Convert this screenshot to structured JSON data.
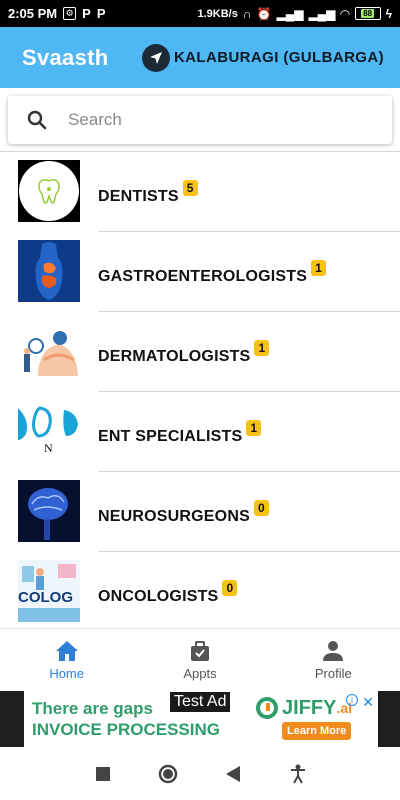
{
  "status_bar": {
    "time": "2:05 PM",
    "left_icons": [
      "settings-icon",
      "p-icon",
      "p-icon"
    ],
    "p_glyph": "P",
    "speed": "1.9KB/s",
    "battery": "88"
  },
  "app_bar": {
    "title": "Svaasth",
    "location": "KALABURAGI (GULBARGA)",
    "color": "#4fb7f3"
  },
  "search": {
    "placeholder": "Search"
  },
  "specialties": [
    {
      "label": "DENTISTS",
      "count": "5",
      "icon": "tooth-icon"
    },
    {
      "label": "GASTROENTEROLOGISTS",
      "count": "1",
      "icon": "digestive-system-icon"
    },
    {
      "label": "DERMATOLOGISTS",
      "count": "1",
      "icon": "skin-exam-icon"
    },
    {
      "label": "ENT SPECIALISTS",
      "count": "1",
      "icon": "ear-nose-icon"
    },
    {
      "label": "NEUROSURGEONS",
      "count": "0",
      "icon": "brain-icon"
    },
    {
      "label": "ONCOLOGISTS",
      "count": "0",
      "icon": "oncology-icon"
    }
  ],
  "thumb_text": {
    "ent": "N",
    "oncology": "COLOG"
  },
  "bottom_nav": [
    {
      "label": "Home",
      "icon": "home-icon",
      "active": true
    },
    {
      "label": "Appts",
      "icon": "briefcase-check-icon",
      "active": false
    },
    {
      "label": "Profile",
      "icon": "person-icon",
      "active": false
    }
  ],
  "ad": {
    "line1": "There are gaps",
    "line2": "INVOICE PROCESSING",
    "test_label": "Test Ad",
    "brand": "JIFFY",
    "brand_suffix": ".ai",
    "cta": "Learn More",
    "info_glyph": "i",
    "close_glyph": "✕"
  },
  "colors": {
    "accent": "#4fb7f3",
    "badge": "#f6c21a",
    "nav_active": "#2f7fd6"
  }
}
